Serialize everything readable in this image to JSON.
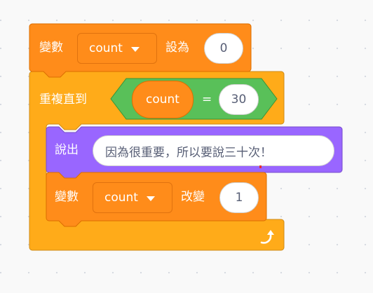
{
  "set_block": {
    "label": "變數",
    "variable": "count",
    "to_label": "設為",
    "value": "0"
  },
  "repeat_block": {
    "label": "重複直到",
    "condition": {
      "left": "count",
      "operator": "=",
      "right": "30"
    },
    "loop_icon": "loop-arrow-icon"
  },
  "say_block": {
    "label": "說出",
    "message": "因為很重要，所以要說三十次！"
  },
  "change_block": {
    "label": "變數",
    "variable": "count",
    "by_label": "改變",
    "value": "1"
  },
  "colors": {
    "variables": "#ff8c1a",
    "control": "#ffab19",
    "operators": "#59c059",
    "looks": "#9966ff",
    "workspace": "#f9f9f9"
  }
}
